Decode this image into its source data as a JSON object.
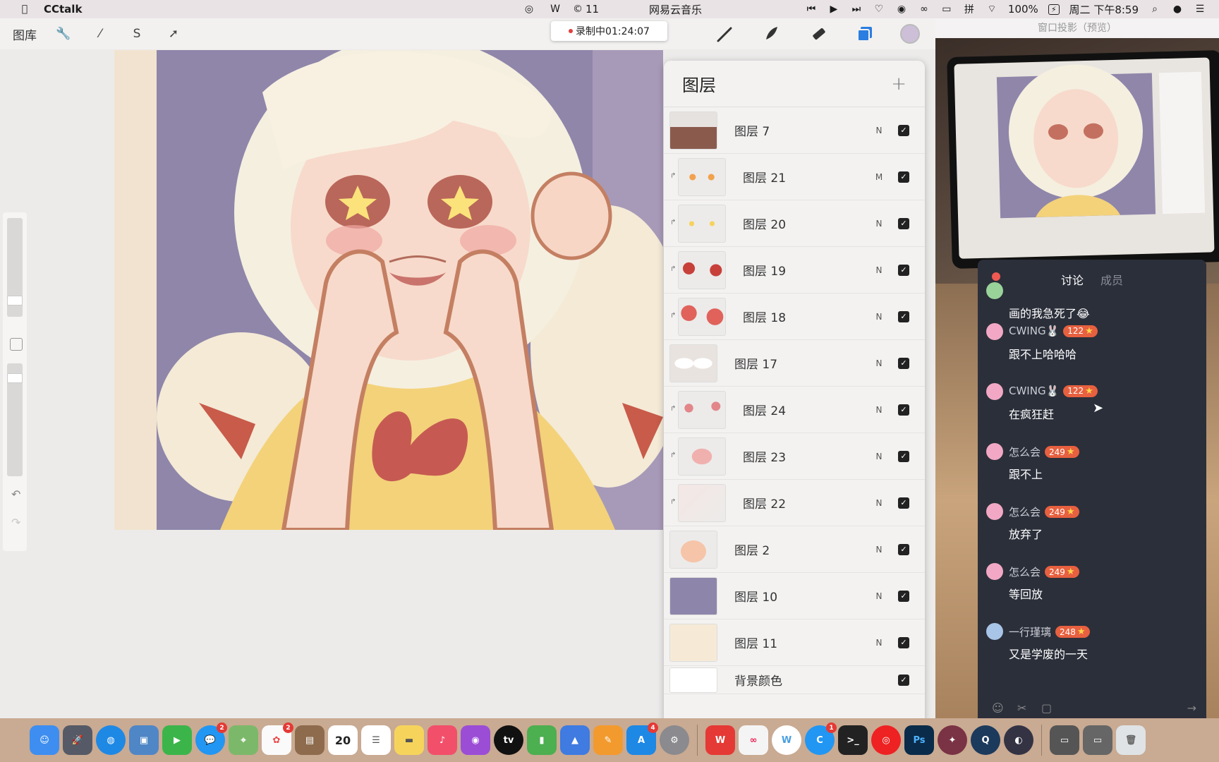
{
  "menubar": {
    "app_name": "CCtalk",
    "notif_count": "11",
    "now_playing": "网易云音乐",
    "battery": "100%",
    "battery_icon_text": "⚡",
    "clock": "周二 下午8:59"
  },
  "procreate": {
    "gallery_label": "图库",
    "recording": "录制中01:24:07",
    "layers_title": "图层",
    "add_symbol": "+",
    "layers": [
      {
        "name": "图层 7",
        "blend": "N",
        "clipped": false,
        "thumb": "mountain-silhouette"
      },
      {
        "name": "图层 21",
        "blend": "M",
        "clipped": true,
        "thumb": "orange-dots"
      },
      {
        "name": "图层 20",
        "blend": "N",
        "clipped": true,
        "thumb": "yellow-dots"
      },
      {
        "name": "图层 19",
        "blend": "N",
        "clipped": true,
        "thumb": "red-dots"
      },
      {
        "name": "图层 18",
        "blend": "N",
        "clipped": true,
        "thumb": "red-blobs"
      },
      {
        "name": "图层 17",
        "blend": "N",
        "clipped": false,
        "thumb": "pale-shapes"
      },
      {
        "name": "图层 24",
        "blend": "N",
        "clipped": true,
        "thumb": "pink-dots"
      },
      {
        "name": "图层 23",
        "blend": "N",
        "clipped": true,
        "thumb": "blush"
      },
      {
        "name": "图层 22",
        "blend": "N",
        "clipped": true,
        "thumb": "sketch"
      },
      {
        "name": "图层 2",
        "blend": "N",
        "clipped": false,
        "thumb": "peach-fill"
      },
      {
        "name": "图层 10",
        "blend": "N",
        "clipped": false,
        "thumb": "lavender-fill"
      },
      {
        "name": "图层 11",
        "blend": "N",
        "clipped": false,
        "thumb": "cream-fill"
      },
      {
        "name": "背景颜色",
        "blend": "",
        "clipped": false,
        "thumb": "white-fill"
      }
    ]
  },
  "projection": {
    "title": "窗口投影（预览）"
  },
  "chat": {
    "tab_active": "讨论",
    "tab_inactive": "成员",
    "messages": [
      {
        "user": "",
        "level": "",
        "text": "画的我急死了😂"
      },
      {
        "user": "CWING🐰",
        "level": "122",
        "text": "跟不上哈哈哈"
      },
      {
        "user": "CWING🐰",
        "level": "122",
        "text": "在疯狂赶"
      },
      {
        "user": "怎么会",
        "level": "249",
        "text": "跟不上"
      },
      {
        "user": "怎么会",
        "level": "249",
        "text": "放弃了"
      },
      {
        "user": "怎么会",
        "level": "249",
        "text": "等回放"
      },
      {
        "user": "一行瑾璃",
        "level": "248",
        "text": "又是学废的一天"
      }
    ]
  },
  "dock": {
    "calendar_day": "20",
    "photoshop_label": "Ps",
    "appletv_label": "tv",
    "wps_label": "W",
    "badges": {
      "messages": "2",
      "photos": "2",
      "appstore": "4",
      "cctalk": "1"
    }
  }
}
